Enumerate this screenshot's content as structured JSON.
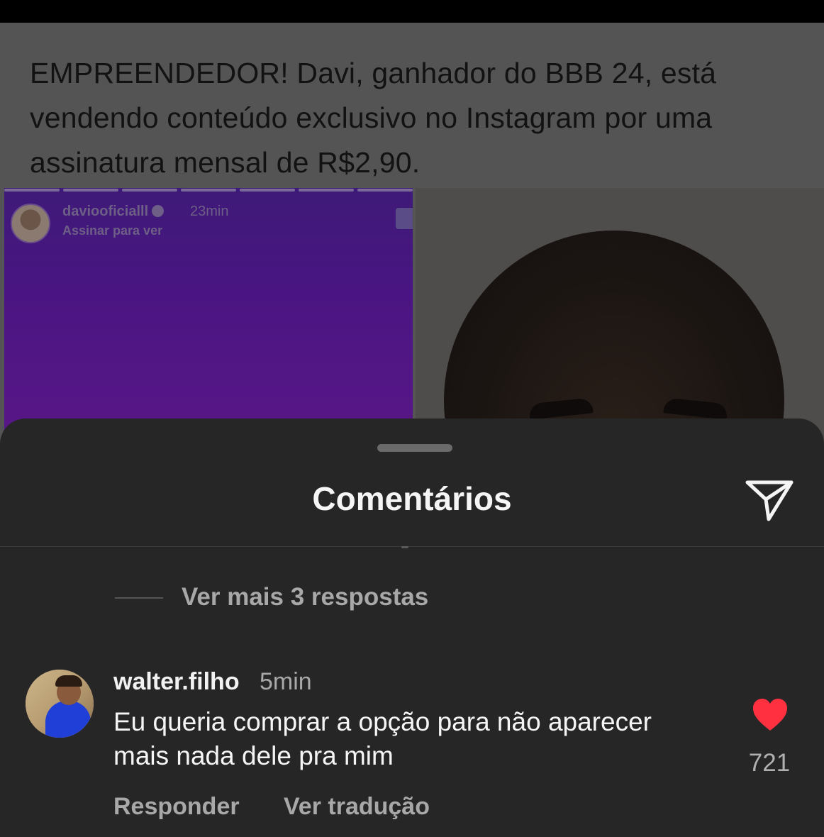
{
  "post": {
    "text": "EMPREENDEDOR! Davi, ganhador do BBB 24, está vendendo conteúdo exclusivo no Instagram por uma assinatura mensal de R$2,90.",
    "story": {
      "username": "daviooficialll",
      "time": "23min",
      "subtitle": "Assinar para ver"
    }
  },
  "sheet": {
    "title": "Comentários",
    "share_icon": "paper-plane-icon",
    "more_replies": "Ver mais 3 respostas"
  },
  "comment": {
    "username": "walter.filho",
    "time": "5min",
    "text": "Eu queria comprar a opção para não aparecer mais nada dele pra mim",
    "likes": "721",
    "liked": true,
    "like_color": "#ff3040",
    "reply_label": "Responder",
    "translate_label": "Ver tradução"
  }
}
